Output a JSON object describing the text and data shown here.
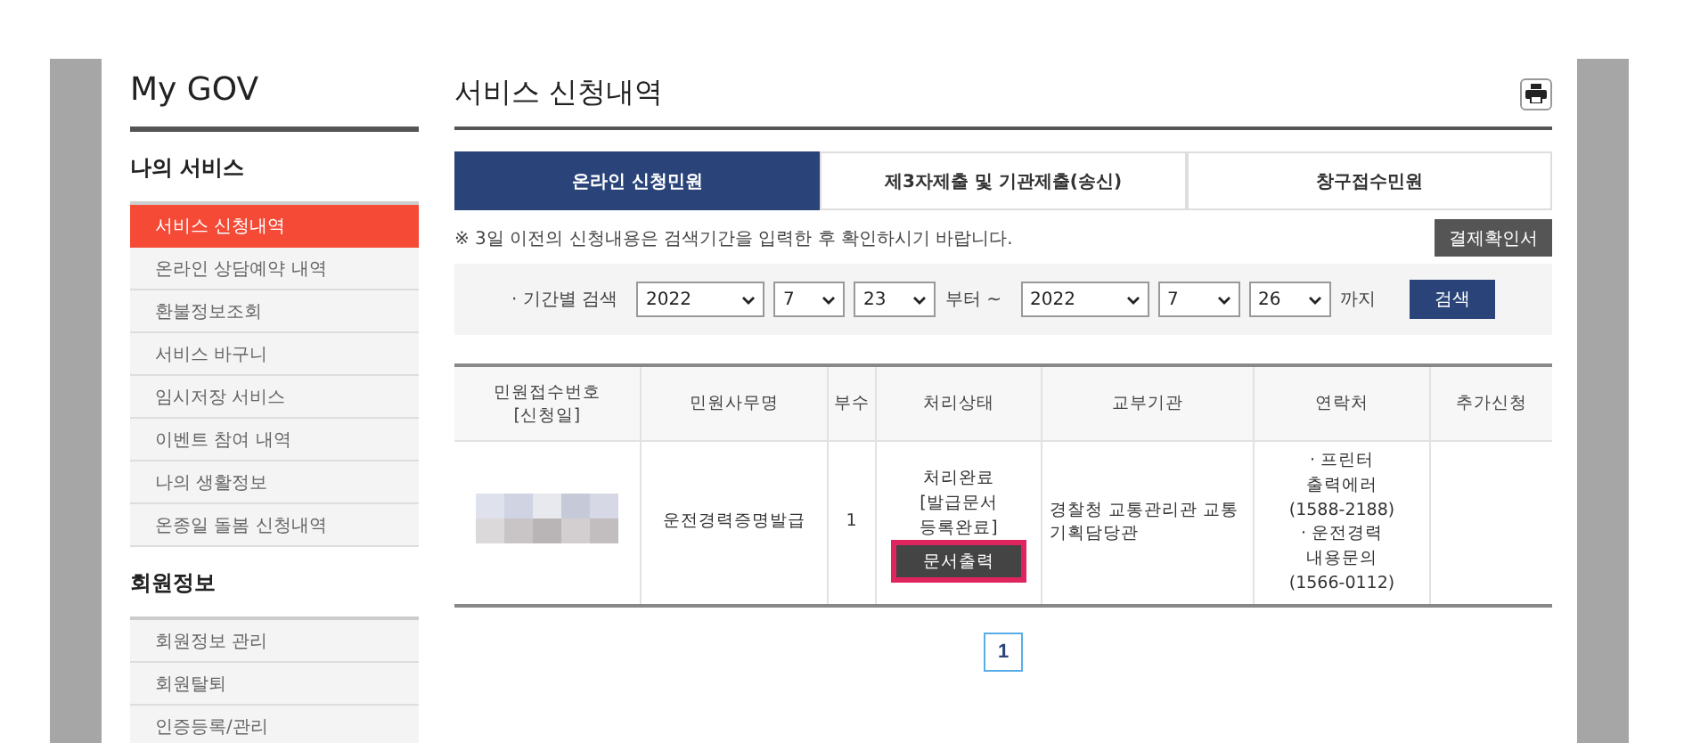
{
  "sidebar": {
    "title": "My GOV",
    "sections": [
      {
        "heading": "나의 서비스",
        "items": [
          {
            "label": "서비스 신청내역",
            "selected": true
          },
          {
            "label": "온라인 상담예약 내역",
            "selected": false
          },
          {
            "label": "환불정보조회",
            "selected": false
          },
          {
            "label": "서비스 바구니",
            "selected": false
          },
          {
            "label": "임시저장 서비스",
            "selected": false
          },
          {
            "label": "이벤트 참여 내역",
            "selected": false
          },
          {
            "label": "나의 생활정보",
            "selected": false
          },
          {
            "label": "온종일 돌봄 신청내역",
            "selected": false
          }
        ]
      },
      {
        "heading": "회원정보",
        "items": [
          {
            "label": "회원정보 관리",
            "selected": false
          },
          {
            "label": "회원탈퇴",
            "selected": false
          },
          {
            "label": "인증등록/관리",
            "selected": false
          }
        ]
      }
    ]
  },
  "page_title": "서비스 신청내역",
  "tabs": [
    {
      "label": "온라인 신청민원",
      "selected": true
    },
    {
      "label": "제3자제출 및 기관제출(송신)",
      "selected": false
    },
    {
      "label": "창구접수민원",
      "selected": false
    }
  ],
  "notice": "※ 3일 이전의 신청내용은 검색기간을 입력한 후 확인하시기 바랍니다.",
  "payment_button": "결제확인서",
  "search": {
    "label": "· 기간별 검색",
    "from": [
      "2022",
      "7",
      "23"
    ],
    "from_suffix": "부터 ~",
    "to": [
      "2022",
      "7",
      "26"
    ],
    "to_suffix": "까지",
    "button": "검색"
  },
  "table": {
    "columns": [
      "민원접수번호\n[신청일]",
      "민원사무명",
      "부수",
      "처리상태",
      "교부기관",
      "연락처",
      "추가신청"
    ],
    "rows": [
      {
        "number": {
          "kind": "redacted"
        },
        "name": "운전경력증명발급",
        "copies": "1",
        "status": "처리완료\n[발급문서\n등록완료]",
        "status_button": "문서출력",
        "highlighted": true,
        "agency": "경찰청 교통관리관 교통기획담당관",
        "contact": [
          "· 프린터\n출력에러",
          "(1588-2188)",
          "· 운전경력\n내용문의",
          "(1566-0112)"
        ]
      }
    ]
  },
  "pagination": [
    {
      "label": "1",
      "selected": true
    }
  ]
}
